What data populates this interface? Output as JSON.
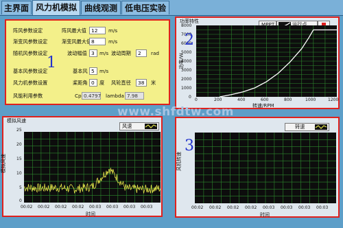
{
  "tabs": [
    {
      "label": "主界面",
      "active": false
    },
    {
      "label": "风力机模拟",
      "active": true
    },
    {
      "label": "曲线观测",
      "active": false
    },
    {
      "label": "低电压实验",
      "active": false
    }
  ],
  "params": {
    "set1": {
      "group": "阵风参数设定",
      "field": "阵风最大值",
      "value": "12",
      "unit": "m/s"
    },
    "set2": {
      "group": "渐变风参数设定",
      "field": "渐变风最大值",
      "value": "8",
      "unit": "m/s"
    },
    "set3": {
      "group": "随机风参数设定",
      "field": "波动幅值",
      "value": "3",
      "unit": "m/s",
      "field2": "波动周期",
      "value2": "2",
      "unit2": "rad"
    },
    "set4": {
      "group": "基本风参数设定",
      "field": "基本风",
      "value": "5",
      "unit": "m/s"
    },
    "set5": {
      "group": "风力机参数设置",
      "field": "桨距角",
      "value": "0",
      "unit": "度",
      "field2": "风轮直径",
      "value2": "38",
      "unit2": "米"
    },
    "set6": {
      "group": "风能利用参数",
      "cp_label": "Cp",
      "cp_value": "0.4797",
      "lambda_label": "lambda",
      "lambda_value": "7.98"
    },
    "marker": "1"
  },
  "watermark": "www.shfdtw.com",
  "power_chart": {
    "title": "功率特性",
    "legend_mppt": "MPPT",
    "legend_run": "运行点",
    "marker": "2",
    "ylabel": "功率/W",
    "xlabel": "转速/RPM",
    "yticks": [
      "8000",
      "7000",
      "6000",
      "5000",
      "4000",
      "3000",
      "2000",
      "1000",
      "0"
    ],
    "xticks": [
      "0",
      "200",
      "400",
      "600",
      "800",
      "1000",
      "1200"
    ]
  },
  "wind_chart": {
    "title": "模拟风速",
    "legend": "风速",
    "ylabel": "模拟风速",
    "xlabel": "时间",
    "yticks": [
      "25",
      "20",
      "15",
      "10",
      "5",
      "0"
    ],
    "xticks": [
      "00:02",
      "00:02",
      "00:02",
      "00:02",
      "00:03",
      "00:03",
      "00:03",
      "00:03",
      "00:03"
    ]
  },
  "speed_chart": {
    "legend": "转速",
    "marker": "3",
    "ylabel": "风机转速",
    "xlabel": "时间",
    "xticks": [
      "00:02",
      "00:02",
      "00:02",
      "00:02",
      "00:03",
      "00:03",
      "00:03",
      "00:03",
      "00:03"
    ]
  },
  "chart_data": [
    {
      "type": "line",
      "title": "功率特性",
      "xlabel": "转速/RPM",
      "ylabel": "功率/W",
      "xlim": [
        0,
        1200
      ],
      "ylim": [
        0,
        8000
      ],
      "grid": true,
      "series": [
        {
          "name": "MPPT",
          "x": [
            200,
            300,
            400,
            500,
            600,
            700,
            800,
            900,
            960,
            1000,
            1200
          ],
          "y": [
            0,
            250,
            560,
            1000,
            1700,
            2650,
            3900,
            5400,
            6600,
            7500,
            7500
          ]
        }
      ]
    },
    {
      "type": "line",
      "title": "模拟风速",
      "xlabel": "时间",
      "ylabel": "模拟风速",
      "ylim": [
        0,
        25
      ],
      "grid": true,
      "categories": [
        "00:02",
        "00:02",
        "00:02",
        "00:02",
        "00:03",
        "00:03",
        "00:03",
        "00:03",
        "00:03"
      ],
      "series": [
        {
          "name": "风速",
          "values": [
            5.4,
            5.1,
            5.3,
            4.8,
            5.6,
            12.0,
            4.9,
            4.7,
            5.0
          ]
        }
      ]
    },
    {
      "type": "line",
      "xlabel": "时间",
      "ylabel": "风机转速",
      "grid": true,
      "categories": [
        "00:02",
        "00:02",
        "00:02",
        "00:02",
        "00:03",
        "00:03",
        "00:03",
        "00:03",
        "00:03"
      ],
      "series": [
        {
          "name": "转速",
          "values": []
        }
      ]
    }
  ]
}
